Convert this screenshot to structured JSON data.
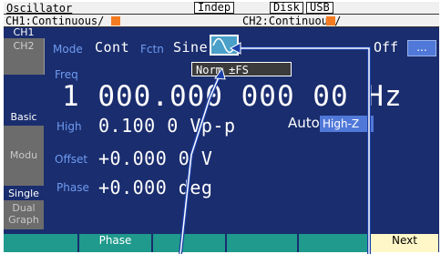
{
  "header": {
    "app_title": "Oscillator",
    "indicator_indep": "Indep",
    "indicator_disk": "Disk",
    "indicator_usb": "USB"
  },
  "channel_bar": {
    "ch1_status": "CH1:Continuous/",
    "ch2_status": "CH2:Continuous/",
    "status_square_color": "#f47b20"
  },
  "left_tabs": {
    "ch1": "CH1",
    "ch2": "CH2",
    "basic": "Basic",
    "modu": "Modu",
    "single": "Single",
    "dual": "Dual",
    "graph": "Graph"
  },
  "params": {
    "mode_label": "Mode",
    "mode_value": "Cont",
    "fctn_label": "Fctn",
    "fctn_value": "Sine",
    "waveform_icon": "sine-wave-icon",
    "output_value": "Off",
    "more_button": "...",
    "range_value": "Norm ±FS",
    "freq_label": "Freq",
    "freq_value": "1 000.000 000 00 Hz",
    "high_label": "High",
    "high_value": "0.100 0 Vp-p",
    "auto_value": "Auto",
    "load_value": "High-Z",
    "offset_label": "Offset",
    "offset_value": "+0.000 0 V",
    "phase_label": "Phase",
    "phase_value": "+0.000 deg"
  },
  "softkeys": [
    "",
    "Phase",
    "",
    "",
    "",
    "Next"
  ],
  "colors": {
    "background": "#1a2d6e",
    "label": "#6f9bf0",
    "accent": "#5078d8",
    "softkey": "#1f9a8c",
    "softkey_next": "#fff7c8",
    "callout": "#1a3fa8"
  }
}
